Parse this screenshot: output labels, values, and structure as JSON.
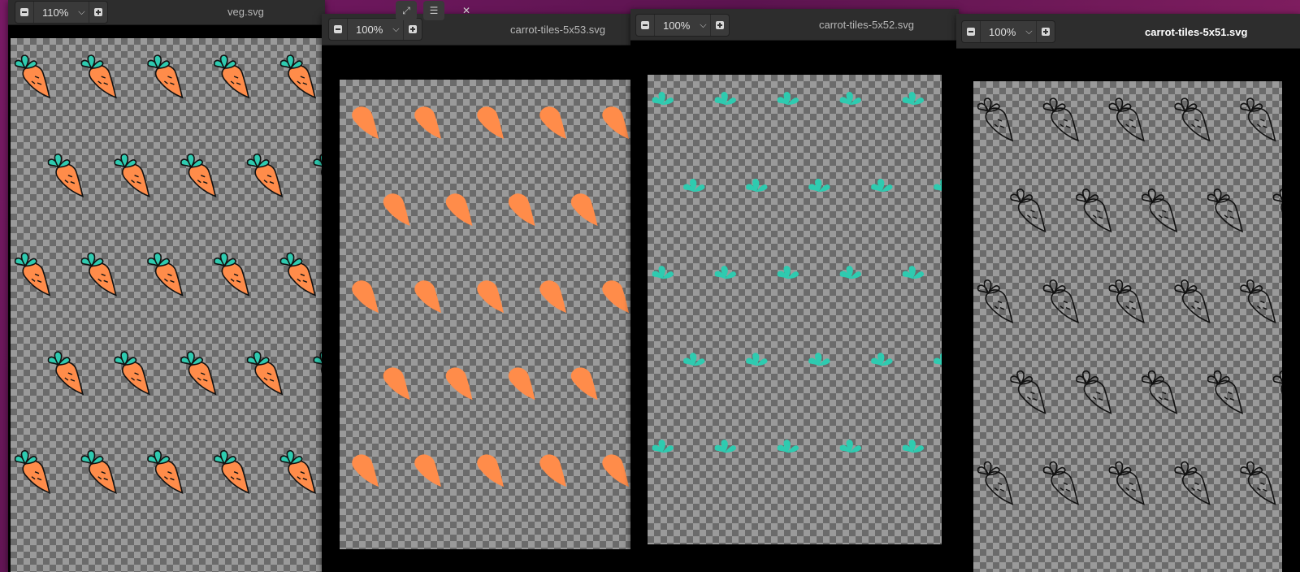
{
  "windows": [
    {
      "title": "veg.svg",
      "zoom": "110%",
      "style": "full",
      "cols": 5,
      "rows": 5
    },
    {
      "title": "carrot-tiles-5x53.svg",
      "zoom": "100%",
      "style": "orange",
      "cols": 5,
      "rows": 5
    },
    {
      "title": "carrot-tiles-5x52.svg",
      "zoom": "100%",
      "style": "teal",
      "cols": 5,
      "rows": 5
    },
    {
      "title": "carrot-tiles-5x51.svg",
      "zoom": "100%",
      "style": "outline",
      "cols": 5,
      "rows": 5
    }
  ],
  "icons": {
    "minus": "zoom-out-icon",
    "plus": "zoom-in-icon",
    "chevron": "chevron-down-icon",
    "expand": "expand-icon",
    "menu": "hamburger-menu-icon",
    "close": "close-icon"
  },
  "colors": {
    "carrot_orange": "#ff8c4a",
    "carrot_leaf": "#2ecbb0",
    "outline": "#111111"
  }
}
